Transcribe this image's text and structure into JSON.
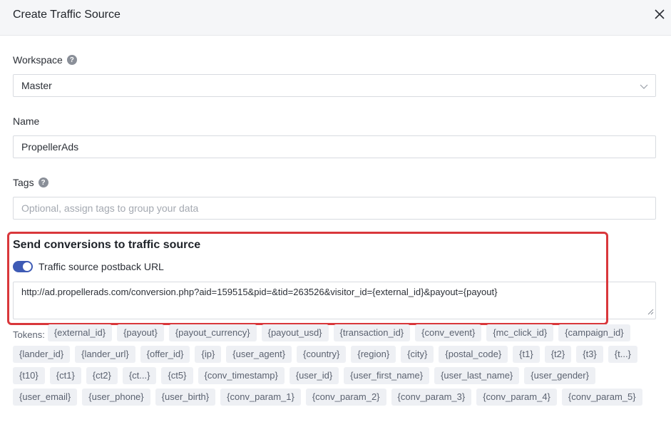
{
  "header": {
    "title": "Create Traffic Source"
  },
  "workspace": {
    "label": "Workspace",
    "value": "Master"
  },
  "name": {
    "label": "Name",
    "value": "PropellerAds"
  },
  "tags": {
    "label": "Tags",
    "placeholder": "Optional, assign tags to group your data"
  },
  "conversions": {
    "title": "Send conversions to traffic source",
    "toggle_label": "Traffic source postback URL",
    "toggle_on": true,
    "postback_url": "http://ad.propellerads.com/conversion.php?aid=159515&pid=&tid=263526&visitor_id={external_id}&payout={payout}"
  },
  "tokens": {
    "label": "Tokens:",
    "items": [
      "{external_id}",
      "{payout}",
      "{payout_currency}",
      "{payout_usd}",
      "{transaction_id}",
      "{conv_event}",
      "{mc_click_id}",
      "{campaign_id}",
      "{lander_id}",
      "{lander_url}",
      "{offer_id}",
      "{ip}",
      "{user_agent}",
      "{country}",
      "{region}",
      "{city}",
      "{postal_code}",
      "{t1}",
      "{t2}",
      "{t3}",
      "{t...}",
      "{t10}",
      "{ct1}",
      "{ct2}",
      "{ct...}",
      "{ct5}",
      "{conv_timestamp}",
      "{user_id}",
      "{user_first_name}",
      "{user_last_name}",
      "{user_gender}",
      "{user_email}",
      "{user_phone}",
      "{user_birth}",
      "{conv_param_1}",
      "{conv_param_2}",
      "{conv_param_3}",
      "{conv_param_4}",
      "{conv_param_5}"
    ]
  },
  "colors": {
    "accent": "#3e5bb5",
    "highlight": "#d9373b"
  }
}
